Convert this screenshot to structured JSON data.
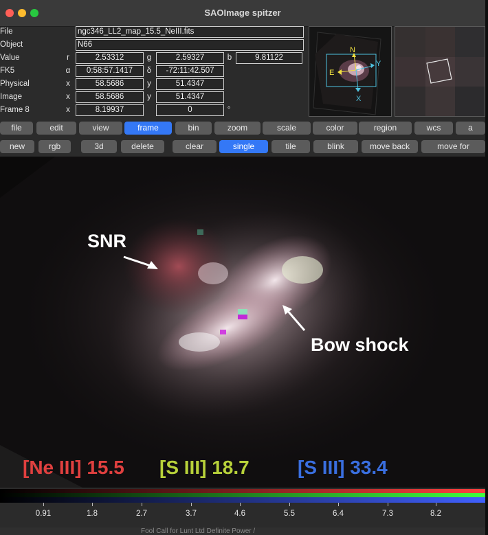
{
  "window": {
    "title": "SAOImage spitzer"
  },
  "info": {
    "file_label": "File",
    "file_value": "ngc346_LL2_map_15.5_NeIII.fits",
    "object_label": "Object",
    "object_value": "N66",
    "value_label": "Value",
    "value_r_label": "r",
    "value_r": "2.53312",
    "value_g_label": "g",
    "value_g": "2.59327",
    "value_b_label": "b",
    "value_b": "9.81122",
    "fk5_label": "FK5",
    "fk5_alpha_label": "α",
    "fk5_alpha": "0:58:57.1417",
    "fk5_delta_label": "δ",
    "fk5_delta": "-72:11:42.507",
    "physical_label": "Physical",
    "physical_x_label": "x",
    "physical_x": "58.5686",
    "physical_y_label": "y",
    "physical_y": "51.4347",
    "image_label": "Image",
    "image_x_label": "x",
    "image_x": "58.5686",
    "image_y_label": "y",
    "image_y": "51.4347",
    "frame_label": "Frame 8",
    "frame_x_label": "x",
    "frame_x": "8.19937",
    "frame_angle": "0",
    "frame_degree_symbol": "°"
  },
  "panner": {
    "north_label": "N",
    "east_label": "E",
    "x_label": "X",
    "y_label": "Y"
  },
  "toolbar_main": [
    {
      "label": "file",
      "active": false
    },
    {
      "label": "edit",
      "active": false
    },
    {
      "label": "view",
      "active": false
    },
    {
      "label": "frame",
      "active": true
    },
    {
      "label": "bin",
      "active": false
    },
    {
      "label": "zoom",
      "active": false
    },
    {
      "label": "scale",
      "active": false
    },
    {
      "label": "color",
      "active": false
    },
    {
      "label": "region",
      "active": false
    },
    {
      "label": "wcs",
      "active": false
    },
    {
      "label": "a",
      "active": false
    }
  ],
  "toolbar_frame": [
    {
      "label": "new",
      "active": false
    },
    {
      "label": "rgb",
      "active": false
    },
    {
      "label": "3d",
      "active": false
    },
    {
      "label": "delete",
      "active": false
    },
    {
      "label": "clear",
      "active": false
    },
    {
      "label": "single",
      "active": true
    },
    {
      "label": "tile",
      "active": false
    },
    {
      "label": "blink",
      "active": false
    },
    {
      "label": "move back",
      "active": false
    },
    {
      "label": "move for",
      "active": false
    }
  ],
  "annotations": {
    "snr_label": "SNR",
    "bow_shock_label": "Bow shock",
    "legend_neiii": "[Ne III] 15.5",
    "legend_siii_187": "[S III] 18.7",
    "legend_siii_334": "[S III] 33.4"
  },
  "colors": {
    "accent_blue": "#3478f6",
    "legend_red": "#e0403f",
    "legend_green": "#b8d23a",
    "legend_blue": "#3a6fe0"
  },
  "colorbar": {
    "ticks": [
      "0.91",
      "1.8",
      "2.7",
      "3.7",
      "4.6",
      "5.5",
      "6.4",
      "7.3",
      "8.2"
    ]
  },
  "background": {
    "bottom_text": "Fool Call for Lunt Ltd  Definite Power /"
  }
}
